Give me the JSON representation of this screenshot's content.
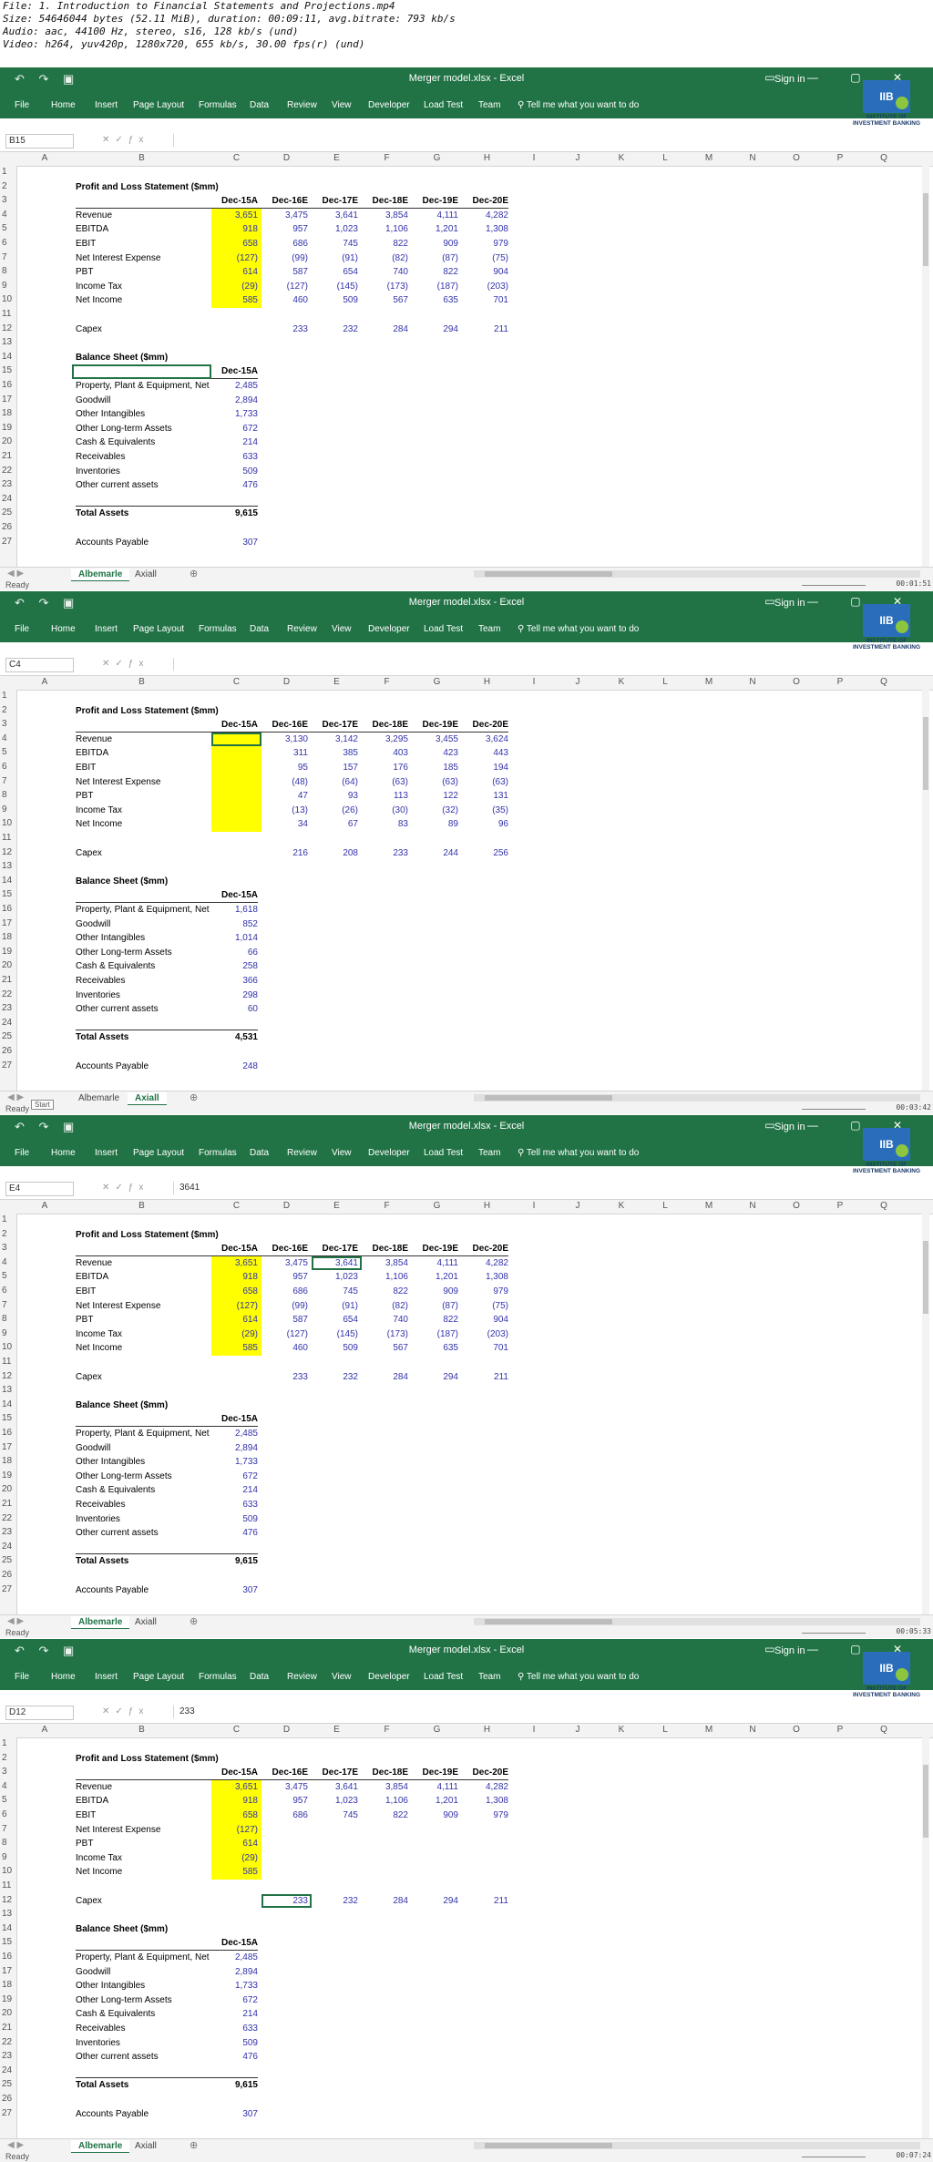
{
  "media_info": [
    "File: 1. Introduction to Financial Statements and Projections.mp4",
    "Size: 54646044 bytes (52.11 MiB), duration: 00:09:11, avg.bitrate: 793 kb/s",
    "Audio: aac, 44100 Hz, stereo, s16, 128 kb/s (und)",
    "Video: h264, yuv420p, 1280x720, 655 kb/s, 30.00 fps(r) (und)"
  ],
  "window_title": "Merger model.xlsx - Excel",
  "sign_in": "Sign in",
  "ribbon_tabs": [
    "File",
    "Home",
    "Insert",
    "Page Layout",
    "Formulas",
    "Data",
    "Review",
    "View",
    "Developer",
    "Load Test",
    "Team"
  ],
  "tell_me": "Tell me what you want to do",
  "logo_text": "INSTITUTE OF INVESTMENT BANKING",
  "columns": [
    "A",
    "B",
    "C",
    "D",
    "E",
    "F",
    "G",
    "H",
    "I",
    "J",
    "K",
    "L",
    "M",
    "N",
    "O",
    "P",
    "Q"
  ],
  "rows": [
    1,
    2,
    3,
    4,
    5,
    6,
    7,
    8,
    9,
    10,
    11,
    12,
    13,
    14,
    15,
    16,
    17,
    18,
    19,
    20,
    21,
    22,
    23,
    24,
    25,
    26,
    27
  ],
  "pl_title": "Profit and Loss Statement ($mm)",
  "year_headers": [
    "Dec-15A",
    "Dec-16E",
    "Dec-17E",
    "Dec-18E",
    "Dec-19E",
    "Dec-20E"
  ],
  "pl_labels": [
    "Revenue",
    "EBITDA",
    "EBIT",
    "Net Interest Expense",
    "PBT",
    "Income Tax",
    "Net Income"
  ],
  "capex_label": "Capex",
  "bs_title": "Balance Sheet ($mm)",
  "bs_header": "Dec-15A",
  "bs_labels": [
    "Property, Plant & Equipment, Net",
    "Goodwill",
    "Other Intangibles",
    "Other Long-term Assets",
    "Cash & Equivalents",
    "Receivables",
    "Inventories",
    "Other current assets"
  ],
  "total_assets_label": "Total Assets",
  "ap_label": "Accounts Payable",
  "status_ready": "Ready",
  "sheet_tabs": [
    "Albemarle",
    "Axiall"
  ],
  "frames": [
    {
      "name_box": "B15",
      "formula": "",
      "active_tab": 0,
      "timestamp": "00:01:51",
      "pl": [
        [
          "3,651",
          "3,475",
          "3,641",
          "3,854",
          "4,111",
          "4,282"
        ],
        [
          "918",
          "957",
          "1,023",
          "1,106",
          "1,201",
          "1,308"
        ],
        [
          "658",
          "686",
          "745",
          "822",
          "909",
          "979"
        ],
        [
          "(127)",
          "(99)",
          "(91)",
          "(82)",
          "(87)",
          "(75)"
        ],
        [
          "614",
          "587",
          "654",
          "740",
          "822",
          "904"
        ],
        [
          "(29)",
          "(127)",
          "(145)",
          "(173)",
          "(187)",
          "(203)"
        ],
        [
          "585",
          "460",
          "509",
          "567",
          "635",
          "701"
        ]
      ],
      "capex": [
        "",
        "233",
        "232",
        "284",
        "294",
        "211"
      ],
      "bs": [
        "2,485",
        "2,894",
        "1,733",
        "672",
        "214",
        "633",
        "509",
        "476"
      ],
      "total_assets": "9,615",
      "ap": "307"
    },
    {
      "name_box": "C4",
      "formula": "",
      "active_tab": 1,
      "timestamp": "00:03:42",
      "pl": [
        [
          "",
          "3,130",
          "3,142",
          "3,295",
          "3,455",
          "3,624"
        ],
        [
          "",
          "311",
          "385",
          "403",
          "423",
          "443"
        ],
        [
          "",
          "95",
          "157",
          "176",
          "185",
          "194"
        ],
        [
          "",
          "(48)",
          "(64)",
          "(63)",
          "(63)",
          "(63)"
        ],
        [
          "",
          "47",
          "93",
          "113",
          "122",
          "131"
        ],
        [
          "",
          "(13)",
          "(26)",
          "(30)",
          "(32)",
          "(35)"
        ],
        [
          "",
          "34",
          "67",
          "83",
          "89",
          "96"
        ]
      ],
      "capex": [
        "",
        "216",
        "208",
        "233",
        "244",
        "256"
      ],
      "bs": [
        "1,618",
        "852",
        "1,014",
        "66",
        "258",
        "366",
        "298",
        "60"
      ],
      "total_assets": "4,531",
      "ap": "248",
      "start_tooltip": "Start"
    },
    {
      "name_box": "E4",
      "formula": "3641",
      "active_tab": 0,
      "timestamp": "00:05:33",
      "pl": [
        [
          "3,651",
          "3,475",
          "3,641",
          "3,854",
          "4,111",
          "4,282"
        ],
        [
          "918",
          "957",
          "1,023",
          "1,106",
          "1,201",
          "1,308"
        ],
        [
          "658",
          "686",
          "745",
          "822",
          "909",
          "979"
        ],
        [
          "(127)",
          "(99)",
          "(91)",
          "(82)",
          "(87)",
          "(75)"
        ],
        [
          "614",
          "587",
          "654",
          "740",
          "822",
          "904"
        ],
        [
          "(29)",
          "(127)",
          "(145)",
          "(173)",
          "(187)",
          "(203)"
        ],
        [
          "585",
          "460",
          "509",
          "567",
          "635",
          "701"
        ]
      ],
      "capex": [
        "",
        "233",
        "232",
        "284",
        "294",
        "211"
      ],
      "bs": [
        "2,485",
        "2,894",
        "1,733",
        "672",
        "214",
        "633",
        "509",
        "476"
      ],
      "total_assets": "9,615",
      "ap": "307"
    },
    {
      "name_box": "D12",
      "formula": "233",
      "active_tab": 0,
      "timestamp": "00:07:24",
      "pl": [
        [
          "3,651",
          "3,475",
          "3,641",
          "3,854",
          "4,111",
          "4,282"
        ],
        [
          "918",
          "957",
          "1,023",
          "1,106",
          "1,201",
          "1,308"
        ],
        [
          "658",
          "686",
          "745",
          "822",
          "909",
          "979"
        ],
        [
          "(127)",
          "",
          "",
          "",
          "",
          ""
        ],
        [
          "614",
          "",
          "",
          "",
          "",
          ""
        ],
        [
          "(29)",
          "",
          "",
          "",
          "",
          ""
        ],
        [
          "585",
          "",
          "",
          "",
          "",
          ""
        ]
      ],
      "capex": [
        "",
        "233",
        "232",
        "284",
        "294",
        "211"
      ],
      "bs": [
        "2,485",
        "2,894",
        "1,733",
        "672",
        "214",
        "633",
        "509",
        "476"
      ],
      "total_assets": "9,615",
      "ap": "307"
    }
  ]
}
